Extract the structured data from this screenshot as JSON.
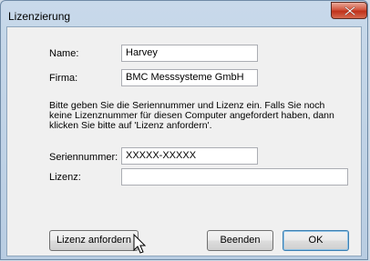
{
  "window": {
    "title": "Lizenzierung"
  },
  "form": {
    "name_label": "Name:",
    "name_value": "Harvey",
    "firma_label": "Firma:",
    "firma_value": "BMC Messsysteme GmbH",
    "info_text": "Bitte geben Sie die Seriennummer und Lizenz ein. Falls Sie noch keine Lizenznummer für diesen Computer angefordert haben, dann klicken Sie bitte auf 'Lizenz anfordern'.",
    "serial_label": "Seriennummer:",
    "serial_value": "XXXXX-XXXXX",
    "license_label": "Lizenz:",
    "license_value": ""
  },
  "buttons": {
    "request_license": "Lizenz anfordern",
    "quit": "Beenden",
    "ok": "OK"
  },
  "icons": {
    "close": "close-icon",
    "cursor": "mouse-pointer-icon"
  }
}
